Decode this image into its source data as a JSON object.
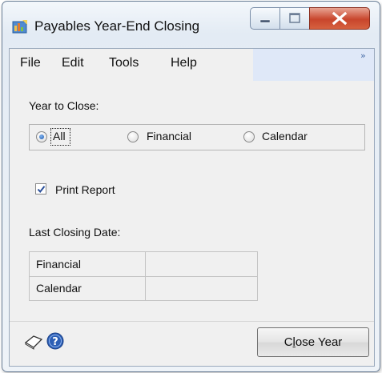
{
  "window": {
    "title": "Payables Year-End Closing"
  },
  "menu": {
    "items": [
      "File",
      "Edit",
      "Tools",
      "Help"
    ],
    "overflow_glyph": "»"
  },
  "year_to_close": {
    "label": "Year to Close:",
    "options": [
      {
        "label": "All",
        "selected": true
      },
      {
        "label": "Financial",
        "selected": false
      },
      {
        "label": "Calendar",
        "selected": false
      }
    ]
  },
  "print_report": {
    "label": "Print Report",
    "checked": true
  },
  "last_closing_date": {
    "label": "Last Closing Date:",
    "rows": [
      {
        "label": "Financial",
        "value": ""
      },
      {
        "label": "Calendar",
        "value": ""
      }
    ]
  },
  "footer": {
    "close_year_button": {
      "pre": "C",
      "accel": "l",
      "post": "ose Year"
    },
    "icons": [
      "note-icon",
      "help-icon"
    ]
  },
  "colors": {
    "menu_extension": "#dfe8f8",
    "close_button": "#c8452c",
    "radio_selected": "#1f5bb0",
    "help_icon": "#2d5fb5"
  }
}
